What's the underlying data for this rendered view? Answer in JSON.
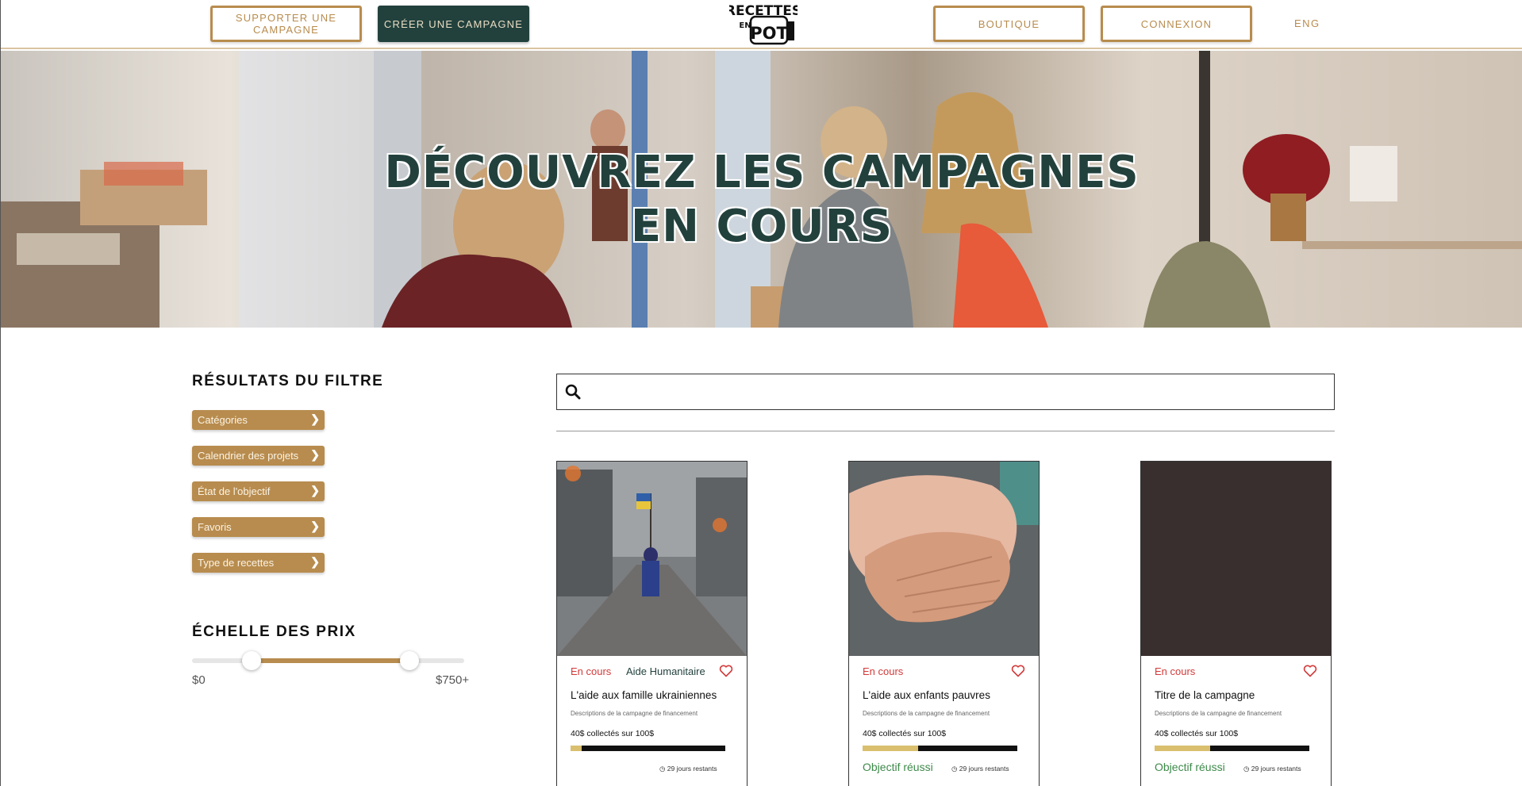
{
  "header": {
    "support_label": "SUPPORTER UNE CAMPAGNE",
    "create_label": "CRÉER UNE CAMPAGNE",
    "logo_text_top": "RECETTES",
    "logo_text_mid": "EN",
    "logo_text_bottom": "POT",
    "shop_label": "BOUTIQUE",
    "login_label": "CONNEXION",
    "lang_label": "ENG"
  },
  "hero": {
    "title_line1": "DÉCOUVREZ LES CAMPAGNES",
    "title_line2": "EN COURS"
  },
  "filters": {
    "title": "RÉSULTATS DU FILTRE",
    "items": [
      {
        "label": "Catégories"
      },
      {
        "label": "Calendrier des projets"
      },
      {
        "label": "État de l'objectif"
      },
      {
        "label": "Favoris"
      },
      {
        "label": "Type de recettes"
      }
    ],
    "chevron": "❯"
  },
  "price": {
    "title": "ÉCHELLE DES PRIX",
    "min_label": "$0",
    "max_label": "$750+",
    "range_low_fraction": 0.22,
    "range_high_fraction": 0.8
  },
  "search": {
    "placeholder": "",
    "value": ""
  },
  "colors": {
    "accent": "#b88c4e",
    "dark_green": "#22413d",
    "status_red": "#d33a3a",
    "success_green": "#3d8a4a",
    "progress": "#d9bf6e"
  },
  "cards": [
    {
      "status": "En cours",
      "category": "Aide Humanitaire",
      "title": "L'aide aux famille ukrainiennes",
      "description": "Descriptions de la campagne de financement",
      "raised": "40$ collectés sur 100$",
      "progress": 0.07,
      "success": "",
      "days": "29 jours restants"
    },
    {
      "status": "En cours",
      "category": "",
      "title": "L'aide aux enfants pauvres",
      "description": "Descriptions de la campagne de financement",
      "raised": "40$ collectés sur 100$",
      "progress": 0.36,
      "success": "Objectif réussi",
      "days": "29 jours restants"
    },
    {
      "status": "En cours",
      "category": "",
      "title": "Titre de la campagne",
      "description": "Descriptions de la campagne de financement",
      "raised": "40$ collectés sur 100$",
      "progress": 0.36,
      "success": "Objectif réussi",
      "days": "29 jours restants"
    }
  ]
}
